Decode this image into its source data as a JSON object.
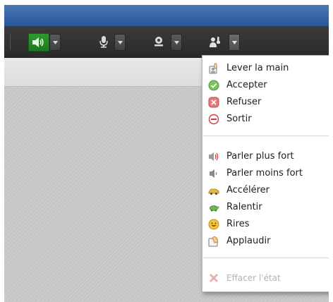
{
  "toolbar": {
    "speaker": {
      "icon": "speaker-icon",
      "active": true,
      "active_color": "#2f9b2f"
    },
    "microphone": {
      "icon": "microphone-icon"
    },
    "webcam": {
      "icon": "webcam-icon"
    },
    "status": {
      "icon": "raise-hand-icon",
      "menu_open": true
    }
  },
  "status_menu": {
    "group1": [
      {
        "label": "Lever la main",
        "icon": "raise-hand-icon"
      },
      {
        "label": "Accepter",
        "icon": "accept-icon",
        "color": "#6cbf4f"
      },
      {
        "label": "Refuser",
        "icon": "refuse-icon",
        "color": "#e06b6b"
      },
      {
        "label": "Sortir",
        "icon": "exit-icon",
        "color": "#d13b3b"
      }
    ],
    "group2": [
      {
        "label": "Parler plus fort",
        "icon": "louder-icon"
      },
      {
        "label": "Parler moins fort",
        "icon": "quieter-icon"
      },
      {
        "label": "Accélérer",
        "icon": "faster-icon",
        "color": "#e0b23a"
      },
      {
        "label": "Ralentir",
        "icon": "slower-icon",
        "color": "#5ea84a"
      },
      {
        "label": "Rires",
        "icon": "laugh-icon",
        "color": "#f2c53d"
      },
      {
        "label": "Applaudir",
        "icon": "applaud-icon"
      }
    ],
    "clear": {
      "label": "Effacer l'état",
      "icon": "clear-status-icon",
      "disabled": true
    }
  }
}
